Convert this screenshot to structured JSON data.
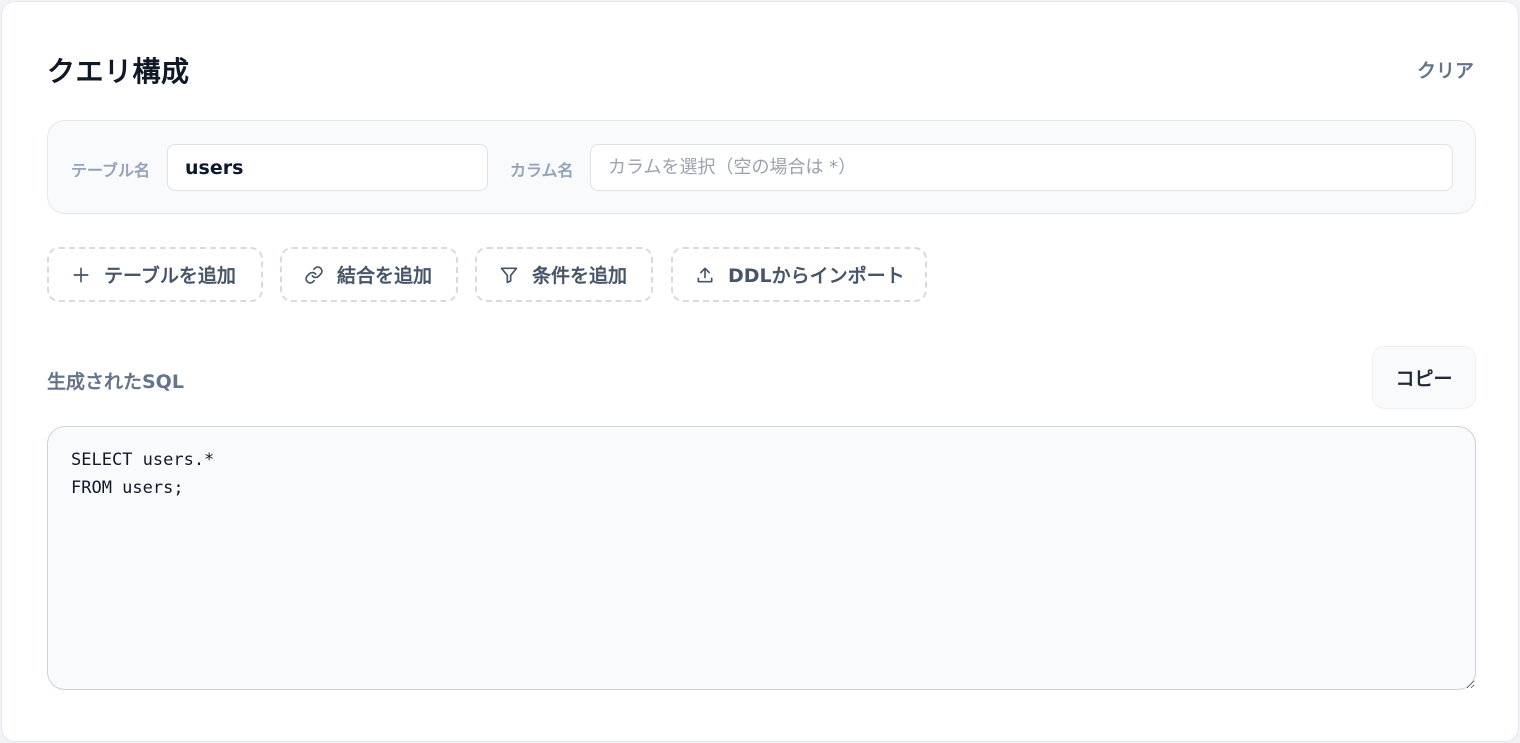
{
  "header": {
    "title": "クエリ構成",
    "clear_label": "クリア"
  },
  "table_section": {
    "table_label": "テーブル名",
    "table_value": "users",
    "column_label": "カラム名",
    "column_value": "",
    "column_placeholder": "カラムを選択（空の場合は *）"
  },
  "actions": [
    {
      "label": "テーブルを追加",
      "icon": "plus-icon"
    },
    {
      "label": "結合を追加",
      "icon": "link-icon"
    },
    {
      "label": "条件を追加",
      "icon": "filter-icon"
    },
    {
      "label": "DDLからインポート",
      "icon": "upload-icon"
    }
  ],
  "sql": {
    "label": "生成されたSQL",
    "copy_label": "コピー",
    "code": "SELECT users.*\nFROM users;"
  }
}
